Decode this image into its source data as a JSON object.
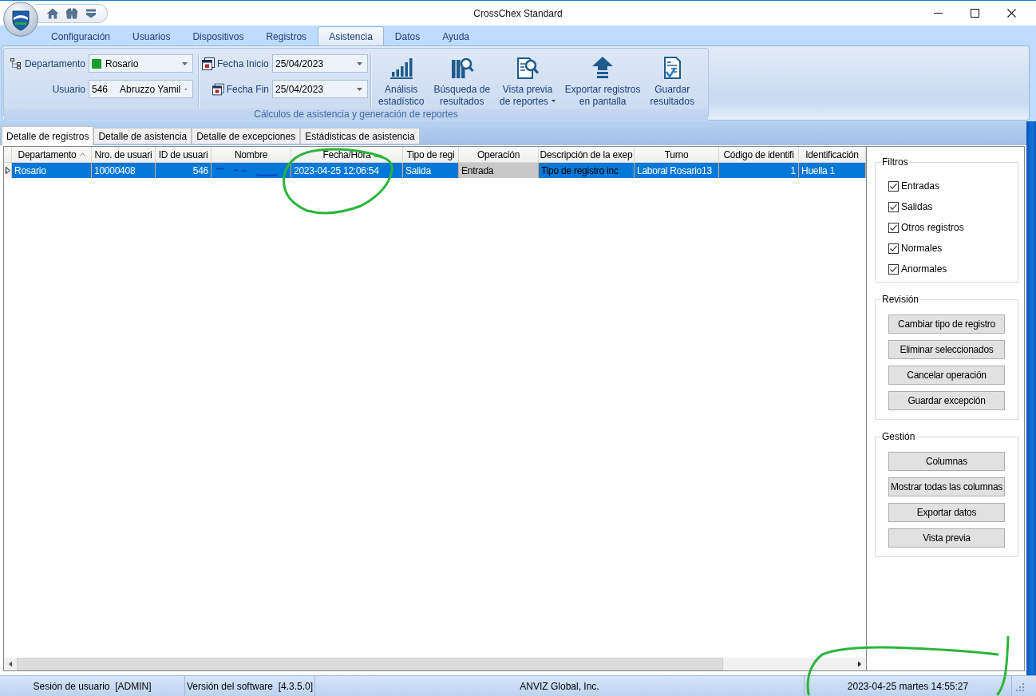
{
  "window": {
    "title": "CrossChex Standard"
  },
  "ribbon": {
    "tabs": [
      {
        "label": "Configuración",
        "selected": false
      },
      {
        "label": "Usuarios",
        "selected": false
      },
      {
        "label": "Dispositivos",
        "selected": false
      },
      {
        "label": "Registros",
        "selected": false
      },
      {
        "label": "Asistencia",
        "selected": true
      },
      {
        "label": "Datos",
        "selected": false
      },
      {
        "label": "Ayuda",
        "selected": false
      }
    ],
    "group": {
      "title": "Cálculos de asistencia y generación de reportes",
      "department": {
        "label": "Departamento",
        "value": "Rosario",
        "color": "#1a9b2a"
      },
      "user": {
        "label": "Usuario",
        "id": "546",
        "name": "Abruzzo Yamil"
      },
      "start_date": {
        "label": "Fecha Inicio",
        "value": "25/04/2023"
      },
      "end_date": {
        "label": "Fecha Fin",
        "value": "25/04/2023"
      },
      "buttons": [
        {
          "kind": "stats",
          "lines": [
            "Análisis",
            "estadístico"
          ],
          "has_menu": false
        },
        {
          "kind": "search",
          "lines": [
            "Búsqueda de",
            "resultados"
          ],
          "has_menu": false
        },
        {
          "kind": "preview",
          "lines": [
            "Vista previa",
            "de reportes"
          ],
          "has_menu": true
        },
        {
          "kind": "export",
          "lines": [
            "Exportar registros",
            "en pantalla"
          ],
          "has_menu": false
        },
        {
          "kind": "save",
          "lines": [
            "Guardar",
            "resultados"
          ],
          "has_menu": false
        }
      ]
    }
  },
  "doc_tabs": [
    {
      "label": "Detalle de registros",
      "selected": true
    },
    {
      "label": "Detalle de asistencia",
      "selected": false
    },
    {
      "label": "Detalle de excepciones",
      "selected": false
    },
    {
      "label": "Estádisticas de asistencia",
      "selected": false
    }
  ],
  "table": {
    "columns": [
      {
        "label": "Departamento",
        "sorted": true,
        "numeric": false
      },
      {
        "label": "Nro. de usuari",
        "sorted": false,
        "numeric": false
      },
      {
        "label": "ID de usuari",
        "sorted": false,
        "numeric": true
      },
      {
        "label": "Nombre",
        "sorted": false,
        "numeric": false
      },
      {
        "label": "Fecha/Hora",
        "sorted": false,
        "numeric": false
      },
      {
        "label": "Tipo de regi",
        "sorted": false,
        "numeric": false
      },
      {
        "label": "Operación",
        "sorted": false,
        "numeric": false
      },
      {
        "label": "Descripción de la exep",
        "sorted": false,
        "numeric": false
      },
      {
        "label": "Turno",
        "sorted": false,
        "numeric": false
      },
      {
        "label": "Código de identifi",
        "sorted": false,
        "numeric": true
      },
      {
        "label": "Identificación",
        "sorted": false,
        "numeric": false
      }
    ],
    "rows": [
      {
        "selected": true,
        "current": true,
        "cells": [
          {
            "text": "Rosario",
            "kind": "plain"
          },
          {
            "text": "10000408",
            "kind": "plain"
          },
          {
            "text": "546",
            "kind": "plain"
          },
          {
            "kind": "redacted"
          },
          {
            "text": "2023-04-25 12:06:54",
            "kind": "plain"
          },
          {
            "text": "Salida",
            "kind": "plain"
          },
          {
            "text": "Entrada",
            "kind": "focused"
          },
          {
            "text": "Tipo de registro inc",
            "kind": "dark"
          },
          {
            "text": "Laboral Rosario13",
            "kind": "plain"
          },
          {
            "text": "1",
            "kind": "plain"
          },
          {
            "text": "Huella 1",
            "kind": "plain"
          }
        ]
      }
    ]
  },
  "side_panel": {
    "groups": [
      {
        "title": "Filtros",
        "items": [
          {
            "kind": "checkbox",
            "label": "Entradas",
            "checked": true
          },
          {
            "kind": "checkbox",
            "label": "Salidas",
            "checked": true
          },
          {
            "kind": "checkbox",
            "label": "Otros registros",
            "checked": true
          },
          {
            "kind": "checkbox",
            "label": "Normales",
            "checked": true
          },
          {
            "kind": "checkbox",
            "label": "Anormales",
            "checked": true
          }
        ]
      },
      {
        "title": "Revisión",
        "items": [
          {
            "kind": "button",
            "label": "Cambiar tipo de registro"
          },
          {
            "kind": "button",
            "label": "Eliminar seleccionados"
          },
          {
            "kind": "button",
            "label": "Cancelar operación"
          },
          {
            "kind": "button",
            "label": "Guardar excepción"
          }
        ]
      },
      {
        "title": "Gestión",
        "items": [
          {
            "kind": "button",
            "label": "Columnas"
          },
          {
            "kind": "button",
            "label": "Mostrar todas las columnas"
          },
          {
            "kind": "button",
            "label": "Exportar datos"
          },
          {
            "kind": "button",
            "label": "Vista previa"
          }
        ]
      }
    ]
  },
  "status_bar": [
    "Sesión de usuario  [ADMIN]",
    "Versión del software  [4.3.5.0]",
    "ANVIZ Global, Inc.",
    "2023-04-25 martes 14:55:27"
  ]
}
